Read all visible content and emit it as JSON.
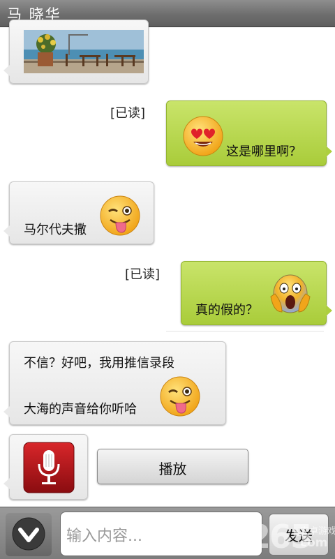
{
  "header": {
    "title": "马 晓华"
  },
  "messages": {
    "m1_read": "[已读]",
    "m1_text": "这是哪里啊？",
    "m2_text": "马尔代夫撒",
    "m3_read": "[已读]",
    "m3_text": "真的假的？",
    "m4_line1": "不信？好吧，我用推信录段",
    "m4_line2": "大海的声音给你听哈"
  },
  "voice": {
    "play_label": "播放"
  },
  "composer": {
    "placeholder": "输入内容...",
    "send_label": "发送"
  },
  "watermark": {
    "number": "2265",
    "site": "安卓游戏网",
    "com": "com"
  },
  "colors": {
    "sent_bubble": "#b3d446",
    "received_bubble": "#ececec",
    "titlebar": "#707070",
    "mic_red": "#b81418"
  },
  "icons": [
    "chevron-down-icon",
    "microphone-icon",
    "heart-eyes-emoji",
    "winking-tongue-emoji",
    "screaming-emoji"
  ]
}
